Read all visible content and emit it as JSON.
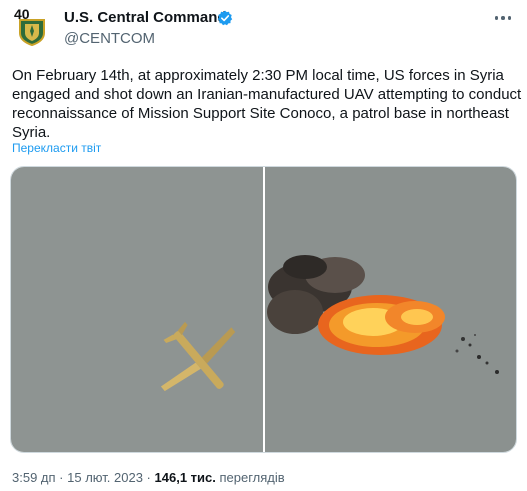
{
  "header": {
    "account_name": "U.S. Central Command",
    "handle": "@CENTCOM",
    "avatar_badge": "40"
  },
  "tweet": {
    "text": "On February 14th, at approximately 2:30 PM local time, US forces in Syria engaged and shot down an Iranian-manufactured UAV attempting to conduct reconnaissance of Mission Support Site Conoco, a patrol base in northeast Syria.",
    "translate_label": "Перекласти твіт"
  },
  "footer": {
    "time": "3:59 дп",
    "separator": "·",
    "date": "15 лют. 2023",
    "views_count": "146,1 тис.",
    "views_label": "переглядів"
  },
  "colors": {
    "link": "#1d9bf0",
    "verified": "#1d9bf0",
    "secondary_text": "#536471",
    "sky": "#8e9492"
  },
  "icons": {
    "verified": "verified-badge-icon",
    "more": "more-options-icon"
  }
}
